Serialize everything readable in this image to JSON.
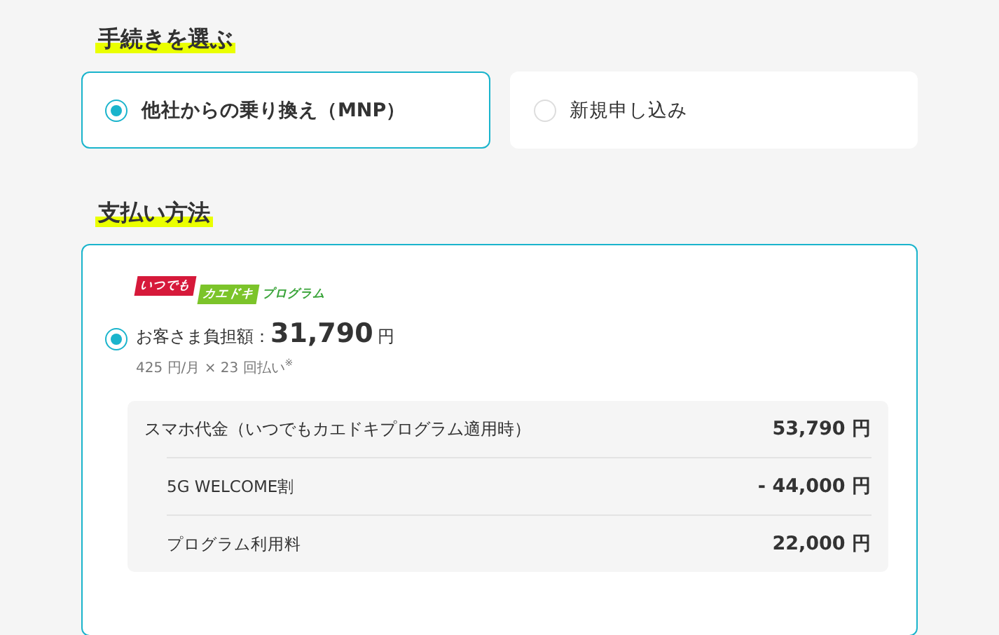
{
  "procedure": {
    "heading": "手続きを選ぶ",
    "options": [
      {
        "label": "他社からの乗り換え（MNP）",
        "selected": true
      },
      {
        "label": "新規申し込み",
        "selected": false
      }
    ]
  },
  "payment": {
    "heading": "支払い方法",
    "plans": [
      {
        "selected": true,
        "logo": {
          "part_1": "いつでも",
          "part_2": "カエドキ",
          "part_3": "プログラム"
        },
        "burden_label": "お客さま負担額：",
        "burden_amount": "31,790",
        "burden_unit": "円",
        "installment": "425 円/月 × 23 回払い$^{※}$",
        "breakdown": [
          {
            "kind": "main",
            "label": "スマホ代金（いつでもカエドキプログラム適用時）",
            "amount": "53,790 円"
          },
          {
            "kind": "sub",
            "label": "5G WELCOME割",
            "amount": "- 44,000 円"
          },
          {
            "kind": "sub",
            "label": "プログラム利用料",
            "amount": "22,000 円"
          }
        ]
      }
    ]
  }
}
